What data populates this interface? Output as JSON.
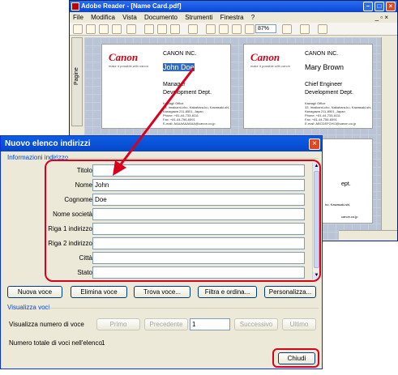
{
  "reader": {
    "title": "Adobe Reader - [Name Card.pdf]",
    "menu": [
      "File",
      "Modifica",
      "Vista",
      "Documento",
      "Strumenti",
      "Finestra",
      "?"
    ],
    "zoom": "87%",
    "pages_tab": "Pagine",
    "cards": [
      {
        "brand": "Canon",
        "tagline": "make it possible with canon",
        "company": "CANON INC.",
        "name": "John Doe",
        "title1": "Manager",
        "title2": "Development Dept.",
        "address": [
          "Kawagii Office",
          "33, Imaikami-cho, Nakahara-ku, Kawasaki-shi,",
          "Kanagawa 211-8501, Japan",
          "Phone: +81-44-733-6111",
          "Fax: +81-44-756-6591",
          "E-mail: AAAAAAAAAA@canon.co.jp"
        ]
      },
      {
        "brand": "Canon",
        "tagline": "make it possible with canon",
        "company": "CANON INC.",
        "name": "Mary Brown",
        "title1": "Chief Engineer",
        "title2": "Development Dept.",
        "address": [
          "Kawagii Office",
          "33, Imaikami-cho, Nakahara-ku, Kawasaki-shi,",
          "Kanagawa 211-8501, Japan",
          "Phone: +81-44-733-6111",
          "Fax: +81-44-756-6591",
          "E-mail: ABCDEFGHIJ@canon.co.jp"
        ]
      }
    ],
    "partial_texts": [
      "ept.",
      "ho, Kawasaki-shi,",
      "canon.co.jp"
    ]
  },
  "dialog": {
    "title": "Nuovo elenco indirizzi",
    "section_info": "Informazioni indirizzo",
    "fields": [
      {
        "label": "Titolo",
        "value": ""
      },
      {
        "label": "Nome",
        "value": "John"
      },
      {
        "label": "Cognome",
        "value": "Doe"
      },
      {
        "label": "Nome società",
        "value": ""
      },
      {
        "label": "Riga 1 indirizzo",
        "value": ""
      },
      {
        "label": "Riga 2 indirizzo",
        "value": ""
      },
      {
        "label": "Città",
        "value": ""
      },
      {
        "label": "Stato",
        "value": ""
      }
    ],
    "buttons": {
      "new_entry": "Nuova voce",
      "delete_entry": "Elimina voce",
      "find_entry": "Trova voce...",
      "filter_sort": "Filtra e ordina...",
      "customize": "Personalizza..."
    },
    "section_view": "Visualizza voci",
    "show_record_label": "Visualizza numero di voce",
    "nav": {
      "first": "Primo",
      "previous": "Precedente",
      "record": "1",
      "next": "Successivo",
      "last": "Ultimo"
    },
    "total_label": "Numero totale di voci nell'elenco",
    "total_value": "1",
    "close": "Chiudi"
  },
  "colors": {
    "annotation": "#d8001c",
    "title_bar": "#0a5ee6",
    "brand": "#d00014"
  }
}
